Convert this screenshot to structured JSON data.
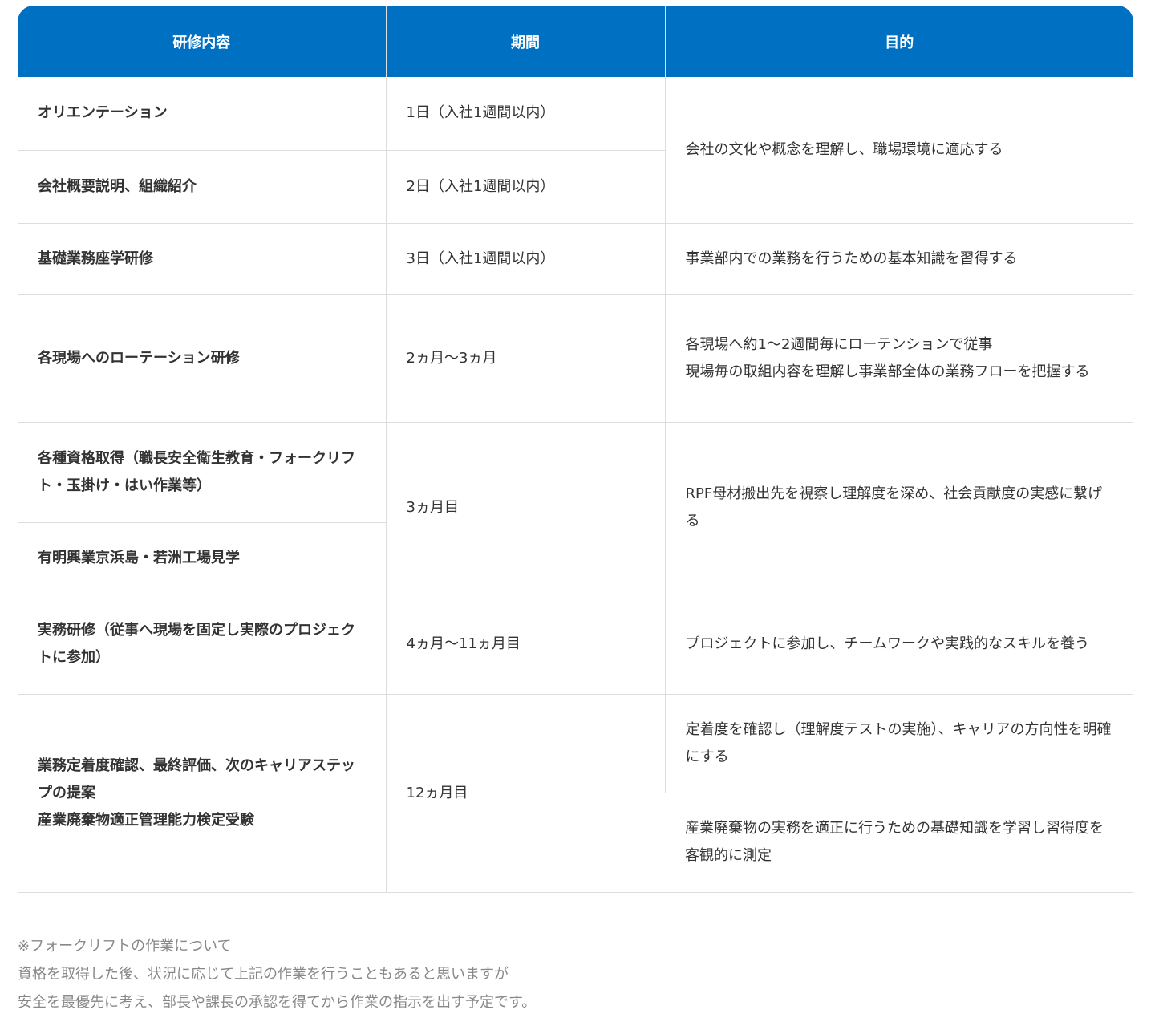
{
  "table": {
    "headers": [
      "研修内容",
      "期間",
      "目的"
    ],
    "rows": [
      {
        "content": "オリエンテーション",
        "period": "1日（入社1週間以内）",
        "purpose": "会社の文化や概念を理解し、職場環境に適応する"
      },
      {
        "content": "会社概要説明、組織紹介",
        "period": "2日（入社1週間以内）"
      },
      {
        "content": "基礎業務座学研修",
        "period": "3日（入社1週間以内）",
        "purpose": "事業部内での業務を行うための基本知識を習得する"
      },
      {
        "content": "各現場へのローテーション研修",
        "period": "2ヵ月～3ヵ月",
        "purpose": "各現場へ約1～2週間毎にローテンションで従事\n現場毎の取組内容を理解し事業部全体の業務フローを把握する"
      },
      {
        "content": "各種資格取得（職長安全衛生教育・フォークリフト・玉掛け・はい作業等）",
        "period": "3ヵ月目",
        "purpose": "RPF母材搬出先を視察し理解度を深め、社会貢献度の実感に繋げる"
      },
      {
        "content": "有明興業京浜島・若洲工場見学"
      },
      {
        "content": "実務研修（従事へ現場を固定し実際のプロジェクトに参加）",
        "period": "4ヵ月～11ヵ月目",
        "purpose": "プロジェクトに参加し、チームワークや実践的なスキルを養う"
      },
      {
        "content": "業務定着度確認、最終評価、次のキャリアステップの提案\n産業廃棄物適正管理能力検定受験",
        "period": "12ヵ月目",
        "purpose": "定着度を確認し（理解度テストの実施）、キャリアの方向性を明確にする"
      },
      {
        "purpose": "産業廃棄物の実務を適正に行うための基礎知識を学習し習得度を客観的に測定"
      }
    ]
  },
  "note": [
    "※フォークリフトの作業について",
    "資格を取得した後、状況に応じて上記の作業を行うこともあると思いますが",
    "安全を最優先に考え、部長や課長の承認を得てから作業の指示を出す予定です。"
  ],
  "colors": {
    "header_bg": "#0071c2",
    "border": "#dddddd",
    "note": "#888888"
  }
}
